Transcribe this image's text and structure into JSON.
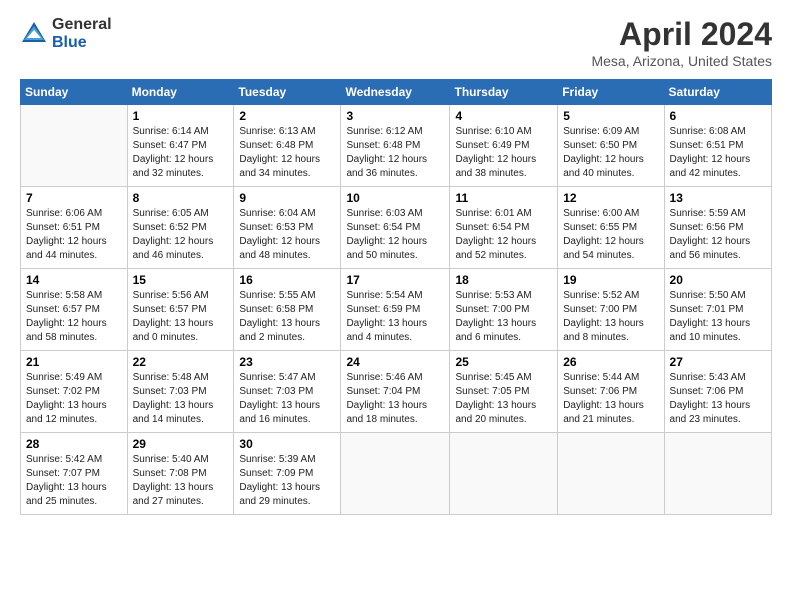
{
  "header": {
    "logo_general": "General",
    "logo_blue": "Blue",
    "title": "April 2024",
    "subtitle": "Mesa, Arizona, United States"
  },
  "days_of_week": [
    "Sunday",
    "Monday",
    "Tuesday",
    "Wednesday",
    "Thursday",
    "Friday",
    "Saturday"
  ],
  "weeks": [
    [
      {
        "day": "",
        "info": ""
      },
      {
        "day": "1",
        "info": "Sunrise: 6:14 AM\nSunset: 6:47 PM\nDaylight: 12 hours\nand 32 minutes."
      },
      {
        "day": "2",
        "info": "Sunrise: 6:13 AM\nSunset: 6:48 PM\nDaylight: 12 hours\nand 34 minutes."
      },
      {
        "day": "3",
        "info": "Sunrise: 6:12 AM\nSunset: 6:48 PM\nDaylight: 12 hours\nand 36 minutes."
      },
      {
        "day": "4",
        "info": "Sunrise: 6:10 AM\nSunset: 6:49 PM\nDaylight: 12 hours\nand 38 minutes."
      },
      {
        "day": "5",
        "info": "Sunrise: 6:09 AM\nSunset: 6:50 PM\nDaylight: 12 hours\nand 40 minutes."
      },
      {
        "day": "6",
        "info": "Sunrise: 6:08 AM\nSunset: 6:51 PM\nDaylight: 12 hours\nand 42 minutes."
      }
    ],
    [
      {
        "day": "7",
        "info": "Sunrise: 6:06 AM\nSunset: 6:51 PM\nDaylight: 12 hours\nand 44 minutes."
      },
      {
        "day": "8",
        "info": "Sunrise: 6:05 AM\nSunset: 6:52 PM\nDaylight: 12 hours\nand 46 minutes."
      },
      {
        "day": "9",
        "info": "Sunrise: 6:04 AM\nSunset: 6:53 PM\nDaylight: 12 hours\nand 48 minutes."
      },
      {
        "day": "10",
        "info": "Sunrise: 6:03 AM\nSunset: 6:54 PM\nDaylight: 12 hours\nand 50 minutes."
      },
      {
        "day": "11",
        "info": "Sunrise: 6:01 AM\nSunset: 6:54 PM\nDaylight: 12 hours\nand 52 minutes."
      },
      {
        "day": "12",
        "info": "Sunrise: 6:00 AM\nSunset: 6:55 PM\nDaylight: 12 hours\nand 54 minutes."
      },
      {
        "day": "13",
        "info": "Sunrise: 5:59 AM\nSunset: 6:56 PM\nDaylight: 12 hours\nand 56 minutes."
      }
    ],
    [
      {
        "day": "14",
        "info": "Sunrise: 5:58 AM\nSunset: 6:57 PM\nDaylight: 12 hours\nand 58 minutes."
      },
      {
        "day": "15",
        "info": "Sunrise: 5:56 AM\nSunset: 6:57 PM\nDaylight: 13 hours\nand 0 minutes."
      },
      {
        "day": "16",
        "info": "Sunrise: 5:55 AM\nSunset: 6:58 PM\nDaylight: 13 hours\nand 2 minutes."
      },
      {
        "day": "17",
        "info": "Sunrise: 5:54 AM\nSunset: 6:59 PM\nDaylight: 13 hours\nand 4 minutes."
      },
      {
        "day": "18",
        "info": "Sunrise: 5:53 AM\nSunset: 7:00 PM\nDaylight: 13 hours\nand 6 minutes."
      },
      {
        "day": "19",
        "info": "Sunrise: 5:52 AM\nSunset: 7:00 PM\nDaylight: 13 hours\nand 8 minutes."
      },
      {
        "day": "20",
        "info": "Sunrise: 5:50 AM\nSunset: 7:01 PM\nDaylight: 13 hours\nand 10 minutes."
      }
    ],
    [
      {
        "day": "21",
        "info": "Sunrise: 5:49 AM\nSunset: 7:02 PM\nDaylight: 13 hours\nand 12 minutes."
      },
      {
        "day": "22",
        "info": "Sunrise: 5:48 AM\nSunset: 7:03 PM\nDaylight: 13 hours\nand 14 minutes."
      },
      {
        "day": "23",
        "info": "Sunrise: 5:47 AM\nSunset: 7:03 PM\nDaylight: 13 hours\nand 16 minutes."
      },
      {
        "day": "24",
        "info": "Sunrise: 5:46 AM\nSunset: 7:04 PM\nDaylight: 13 hours\nand 18 minutes."
      },
      {
        "day": "25",
        "info": "Sunrise: 5:45 AM\nSunset: 7:05 PM\nDaylight: 13 hours\nand 20 minutes."
      },
      {
        "day": "26",
        "info": "Sunrise: 5:44 AM\nSunset: 7:06 PM\nDaylight: 13 hours\nand 21 minutes."
      },
      {
        "day": "27",
        "info": "Sunrise: 5:43 AM\nSunset: 7:06 PM\nDaylight: 13 hours\nand 23 minutes."
      }
    ],
    [
      {
        "day": "28",
        "info": "Sunrise: 5:42 AM\nSunset: 7:07 PM\nDaylight: 13 hours\nand 25 minutes."
      },
      {
        "day": "29",
        "info": "Sunrise: 5:40 AM\nSunset: 7:08 PM\nDaylight: 13 hours\nand 27 minutes."
      },
      {
        "day": "30",
        "info": "Sunrise: 5:39 AM\nSunset: 7:09 PM\nDaylight: 13 hours\nand 29 minutes."
      },
      {
        "day": "",
        "info": ""
      },
      {
        "day": "",
        "info": ""
      },
      {
        "day": "",
        "info": ""
      },
      {
        "day": "",
        "info": ""
      }
    ]
  ]
}
